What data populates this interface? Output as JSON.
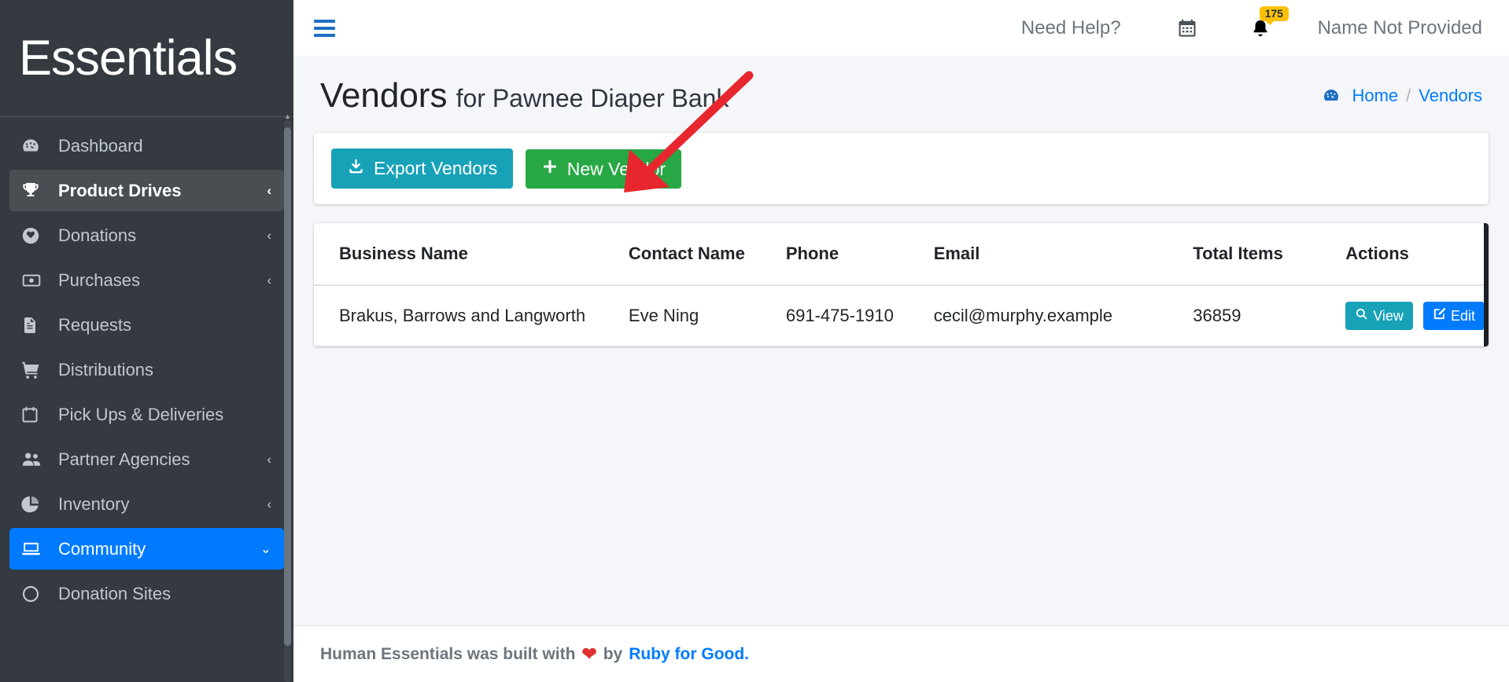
{
  "brand": {
    "name": "Essentials"
  },
  "sidebar": {
    "items": [
      {
        "label": "Dashboard",
        "icon": "tachometer-icon",
        "state": "normal",
        "chevron": ""
      },
      {
        "label": "Product Drives",
        "icon": "trophy-icon",
        "state": "active-soft",
        "chevron": "‹"
      },
      {
        "label": "Donations",
        "icon": "heart-circle-icon",
        "state": "normal",
        "chevron": "‹"
      },
      {
        "label": "Purchases",
        "icon": "money-bill-icon",
        "state": "normal",
        "chevron": "‹"
      },
      {
        "label": "Requests",
        "icon": "file-lines-icon",
        "state": "normal",
        "chevron": ""
      },
      {
        "label": "Distributions",
        "icon": "shopping-cart-icon",
        "state": "normal",
        "chevron": ""
      },
      {
        "label": "Pick Ups & Deliveries",
        "icon": "calendar-icon",
        "state": "normal",
        "chevron": ""
      },
      {
        "label": "Partner Agencies",
        "icon": "users-icon",
        "state": "normal",
        "chevron": "‹"
      },
      {
        "label": "Inventory",
        "icon": "chart-pie-icon",
        "state": "normal",
        "chevron": "‹"
      },
      {
        "label": "Community",
        "icon": "laptop-icon",
        "state": "active-blue",
        "chevron": "⌄"
      },
      {
        "label": "Donation Sites",
        "icon": "circle-icon",
        "state": "normal",
        "chevron": ""
      }
    ]
  },
  "topbar": {
    "menu_toggle": "hamburger-menu",
    "need_help": "Need Help?",
    "calendar_icon": "calendar-icon",
    "notifications_icon": "bell-icon",
    "notifications_count": "175",
    "user_name": "Name Not Provided"
  },
  "header": {
    "title_primary": "Vendors",
    "title_suffix": "for Pawnee Diaper Bank",
    "breadcrumb": {
      "home": "Home",
      "separator": "/",
      "current": "Vendors"
    }
  },
  "actions": {
    "export_label": "Export Vendors",
    "new_label": "New Vendor"
  },
  "table": {
    "columns": [
      "Business Name",
      "Contact Name",
      "Phone",
      "Email",
      "Total Items",
      "Actions"
    ],
    "rows": [
      {
        "business_name": "Brakus, Barrows and Langworth",
        "contact_name": "Eve Ning",
        "phone": "691-475-1910",
        "email": "cecil@murphy.example",
        "total_items": "36859",
        "view_label": "View",
        "edit_label": "Edit"
      }
    ]
  },
  "footer": {
    "text_before": "Human Essentials was built with",
    "heart": "❤",
    "by": "by",
    "link": "Ruby for Good."
  },
  "annotation": {
    "arrow_color": "#e8262d"
  },
  "colors": {
    "sidebar_bg": "#343a40",
    "active_blue": "#007bff",
    "teal": "#17a2b8",
    "green": "#28a745",
    "badge_yellow": "#ffc107"
  }
}
